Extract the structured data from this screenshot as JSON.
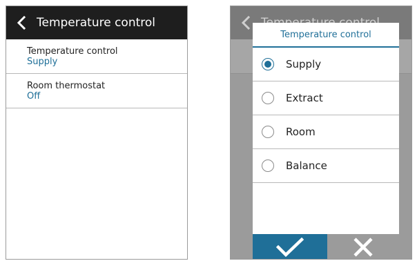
{
  "left_screen": {
    "header": {
      "title": "Temperature control",
      "back_icon": "chevron-left-icon"
    },
    "items": [
      {
        "label": "Temperature control",
        "value": "Supply"
      },
      {
        "label": "Room thermostat",
        "value": "Off"
      }
    ]
  },
  "right_screen": {
    "header": {
      "title": "Temperature control",
      "back_icon": "chevron-left-icon"
    },
    "dialog": {
      "title": "Temperature control",
      "options": [
        {
          "label": "Supply",
          "selected": true
        },
        {
          "label": "Extract",
          "selected": false
        },
        {
          "label": "Room",
          "selected": false
        },
        {
          "label": "Balance",
          "selected": false
        }
      ],
      "ok_icon": "checkmark-icon",
      "cancel_icon": "close-icon"
    }
  },
  "colors": {
    "header_bg": "#1e1e1e",
    "accent": "#1f6f98",
    "overlay_bg": "#9b9b9b",
    "divider": "#b8b8b8"
  }
}
